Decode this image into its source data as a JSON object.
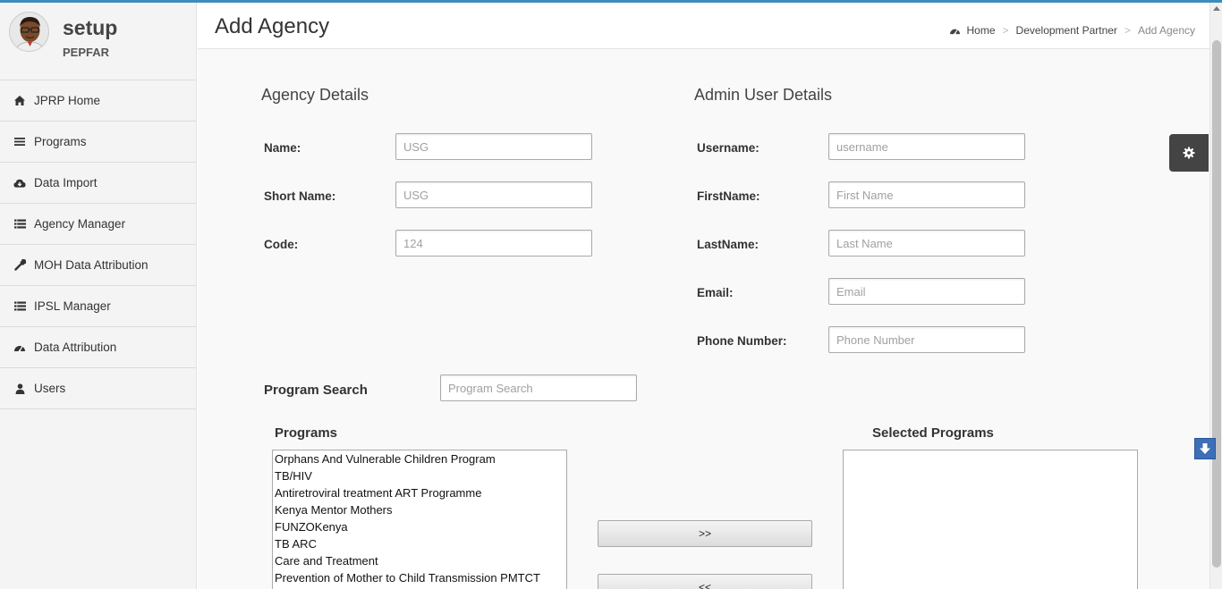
{
  "colors": {
    "accent": "#3c8dbc",
    "sidebar_bg": "#f4f4f4",
    "settings_tab": "#444444"
  },
  "user": {
    "name": "setup",
    "org": "PEPFAR"
  },
  "sidebar": {
    "items": [
      {
        "label": "JPRP Home",
        "icon": "home-icon"
      },
      {
        "label": "Programs",
        "icon": "bars-icon"
      },
      {
        "label": "Data Import",
        "icon": "cloud-download-icon"
      },
      {
        "label": "Agency Manager",
        "icon": "list-icon"
      },
      {
        "label": "MOH Data Attribution",
        "icon": "wrench-icon"
      },
      {
        "label": "IPSL Manager",
        "icon": "list-icon"
      },
      {
        "label": "Data Attribution",
        "icon": "dashboard-icon"
      },
      {
        "label": "Users",
        "icon": "user-icon"
      }
    ]
  },
  "header": {
    "title": "Add Agency",
    "breadcrumb": {
      "home": "Home",
      "parent": "Development Partner",
      "current": "Add Agency"
    }
  },
  "agency": {
    "title": "Agency Details",
    "name_label": "Name:",
    "name_placeholder": "USG",
    "short_label": "Short Name:",
    "short_placeholder": "USG",
    "code_label": "Code:",
    "code_placeholder": "124"
  },
  "admin": {
    "title": "Admin User Details",
    "username_label": "Username:",
    "username_placeholder": "username",
    "first_label": "FirstName:",
    "first_placeholder": "First Name",
    "last_label": "LastName:",
    "last_placeholder": "Last Name",
    "email_label": "Email:",
    "email_placeholder": "Email",
    "phone_label": "Phone Number:",
    "phone_placeholder": "Phone Number"
  },
  "program_search": {
    "label": "Program Search",
    "placeholder": "Program Search"
  },
  "programs": {
    "title": "Programs",
    "items": [
      "Orphans And Vulnerable Children Program",
      "TB/HIV",
      "Antiretroviral treatment ART Programme",
      "Kenya Mentor Mothers",
      "FUNZOKenya",
      "TB ARC",
      "Care and Treatment",
      "Prevention of Mother to Child Transmission PMTCT"
    ]
  },
  "selected_programs": {
    "title": "Selected Programs"
  },
  "buttons": {
    "add": ">>",
    "remove": "<<"
  }
}
